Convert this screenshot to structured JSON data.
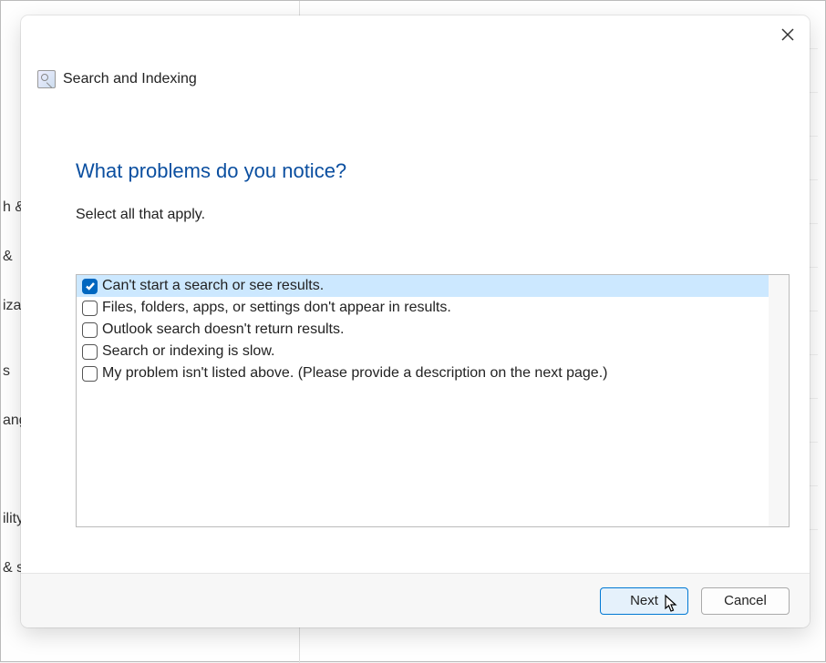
{
  "window_title": "Search and Indexing",
  "heading": "What problems do you notice?",
  "subtext": "Select all that apply.",
  "problems": [
    {
      "label": "Can't start a search or see results.",
      "checked": true
    },
    {
      "label": "Files, folders, apps, or settings don't appear in results.",
      "checked": false
    },
    {
      "label": "Outlook search doesn't return results.",
      "checked": false
    },
    {
      "label": "Search or indexing is slow.",
      "checked": false
    },
    {
      "label": "My problem isn't listed above. (Please provide a description on the next page.)",
      "checked": false
    }
  ],
  "buttons": {
    "next": "Next",
    "cancel": "Cancel"
  },
  "bg_sidebar": {
    "item1": "h &",
    "item2": " &",
    "item3": "izat",
    "item4": "s",
    "item5": "ang",
    "item6": "ility",
    "item7": "& security"
  }
}
